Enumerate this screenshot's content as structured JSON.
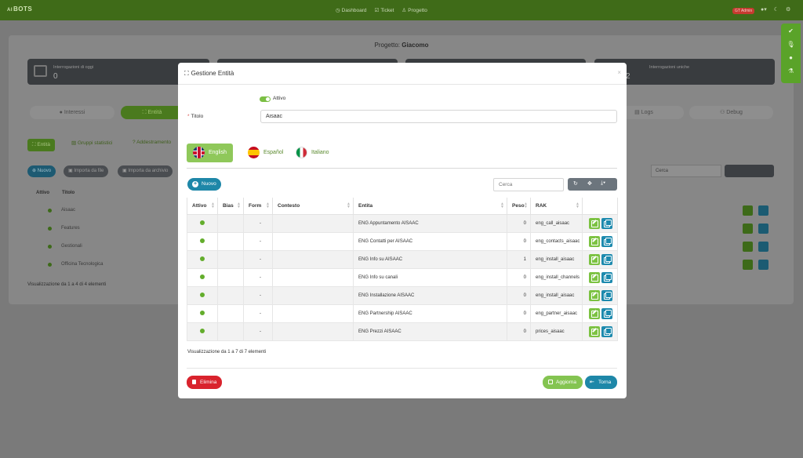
{
  "topbar": {
    "logo_prefix": "AI",
    "logo": "BOTS",
    "nav": [
      {
        "icon": "dashboard-icon",
        "label": "Dashboard"
      },
      {
        "icon": "ticket-icon",
        "label": "Ticket"
      },
      {
        "icon": "person-icon",
        "label": "Progetto"
      }
    ],
    "admin_badge": "GT Admin"
  },
  "background": {
    "project_label": "Progetto:",
    "project_name": "Giacomo",
    "stats": [
      {
        "label": "Interrogazioni di oggi",
        "value": "0"
      },
      {
        "label": "Interrogazioni uniche",
        "value": "2"
      }
    ],
    "tabs": {
      "interessi": "Interessi",
      "entita": "Entità",
      "logs": "Logs",
      "debug": "Debug"
    },
    "subtabs": {
      "entita": "Entità",
      "gruppi": "Gruppi statistici",
      "addestramento": "Addestramento"
    },
    "buttons": {
      "nuovo": "Nuovo",
      "importa_file": "Importa da file",
      "importa_archivio": "Importa da archivio"
    },
    "search_placeholder": "Cerca",
    "columns": {
      "attivo": "Attivo",
      "titolo": "Titolo"
    },
    "rows": [
      "Aisaac",
      "Features",
      "Gestionali",
      "Officina Tecnologica"
    ],
    "footer": "Visualizzazione da 1 a 4 di 4 elementi"
  },
  "modal": {
    "title": "Gestione Entità",
    "toggle_label": "Attivo",
    "title_field_label": "Titolo",
    "title_field_value": "Aisaac",
    "languages": [
      {
        "label": "English",
        "active": true
      },
      {
        "label": "Español",
        "active": false
      },
      {
        "label": "Italiano",
        "active": false
      }
    ],
    "new_button": "Nuovo",
    "search_placeholder": "Cerca",
    "columns": {
      "attivo": "Attivo",
      "bias": "Bias",
      "form": "Form",
      "contesto": "Contesto",
      "entita": "Entita",
      "peso": "Peso",
      "rak": "RAK"
    },
    "rows": [
      {
        "form": "-",
        "entita": "ENG Appuntamento AISAAC",
        "peso": "0",
        "rak": "eng_call_aisaac"
      },
      {
        "form": "-",
        "entita": "ENG Contatti per AISAAC",
        "peso": "0",
        "rak": "eng_contacts_aisaac"
      },
      {
        "form": "-",
        "entita": "ENG Info su AISAAC",
        "peso": "1",
        "rak": "eng_install_aisaac"
      },
      {
        "form": "-",
        "entita": "ENG Info su canali",
        "peso": "0",
        "rak": "eng_install_channels"
      },
      {
        "form": "-",
        "entita": "ENG Installazione AISAAC",
        "peso": "0",
        "rak": "eng_install_aisaac"
      },
      {
        "form": "-",
        "entita": "ENG Partnership AISAAC",
        "peso": "0",
        "rak": "eng_partner_aisaac"
      },
      {
        "form": "-",
        "entita": "ENG Prezzi AISAAC",
        "peso": "0",
        "rak": "prices_aisaac"
      }
    ],
    "info": "Visualizzazione da 1 a 7 di 7 elementi",
    "buttons": {
      "elimina": "Elimina",
      "aggiorna": "Aggiorna",
      "torna": "Torna"
    }
  },
  "colors": {
    "topbar": "#3f6b18",
    "accent_green": "#7cc242",
    "accent_blue": "#1e87a8",
    "danger": "#d9232d"
  }
}
